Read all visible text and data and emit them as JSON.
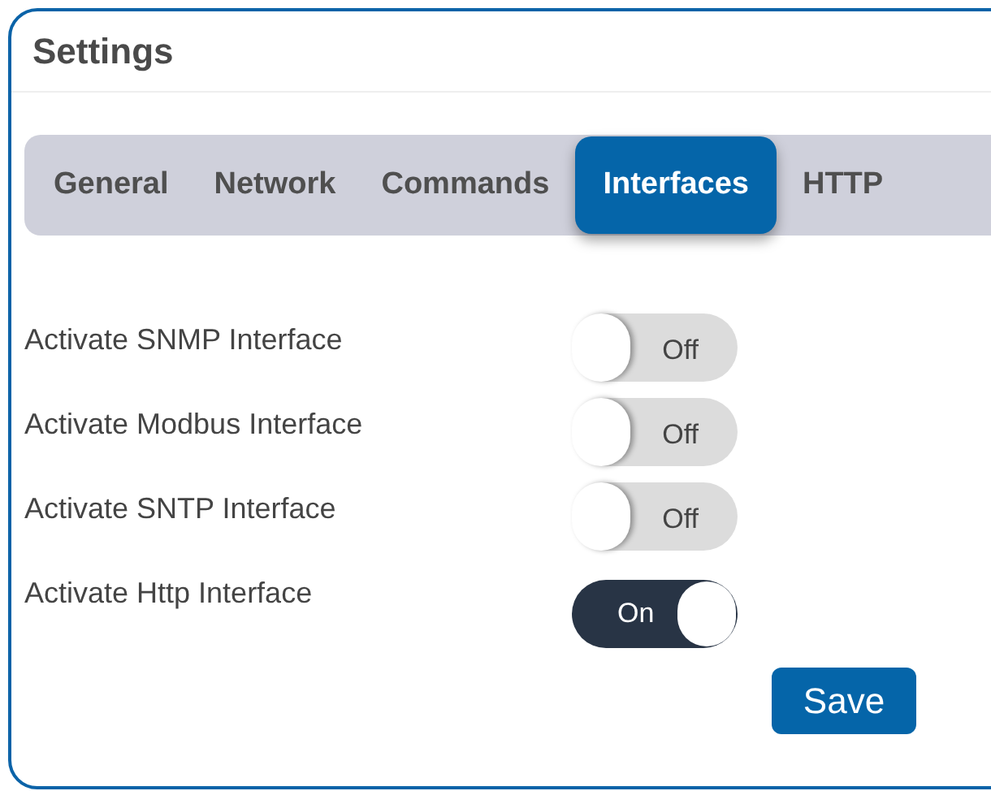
{
  "title": "Settings",
  "tabs": [
    {
      "label": "General",
      "selected": false
    },
    {
      "label": "Network",
      "selected": false
    },
    {
      "label": "Commands",
      "selected": false
    },
    {
      "label": "Interfaces",
      "selected": true
    },
    {
      "label": "HTTP",
      "selected": false
    }
  ],
  "options": [
    {
      "label": "Activate SNMP Interface",
      "on": false,
      "state_text": "Off"
    },
    {
      "label": "Activate Modbus Interface",
      "on": false,
      "state_text": "Off"
    },
    {
      "label": "Activate SNTP Interface",
      "on": false,
      "state_text": "Off"
    },
    {
      "label": "Activate Http Interface",
      "on": true,
      "state_text": "On"
    }
  ],
  "save_button": "Save"
}
